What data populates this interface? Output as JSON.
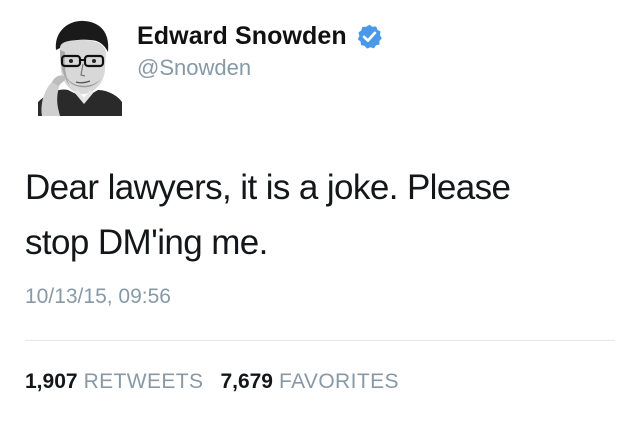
{
  "user": {
    "display_name": "Edward Snowden",
    "handle": "@Snowden",
    "verified": true,
    "verified_icon": "verified-badge-icon",
    "verified_color": "#4a99e9",
    "avatar_icon": "profile-photo"
  },
  "tweet": {
    "text_line1": "Dear lawyers, it is a joke. Please",
    "text_line2": "stop DM'ing me.",
    "timestamp": "10/13/15, 09:56"
  },
  "stats": {
    "retweets_count": "1,907",
    "retweets_label": "RETWEETS",
    "favorites_count": "7,679",
    "favorites_label": "FAVORITES"
  }
}
